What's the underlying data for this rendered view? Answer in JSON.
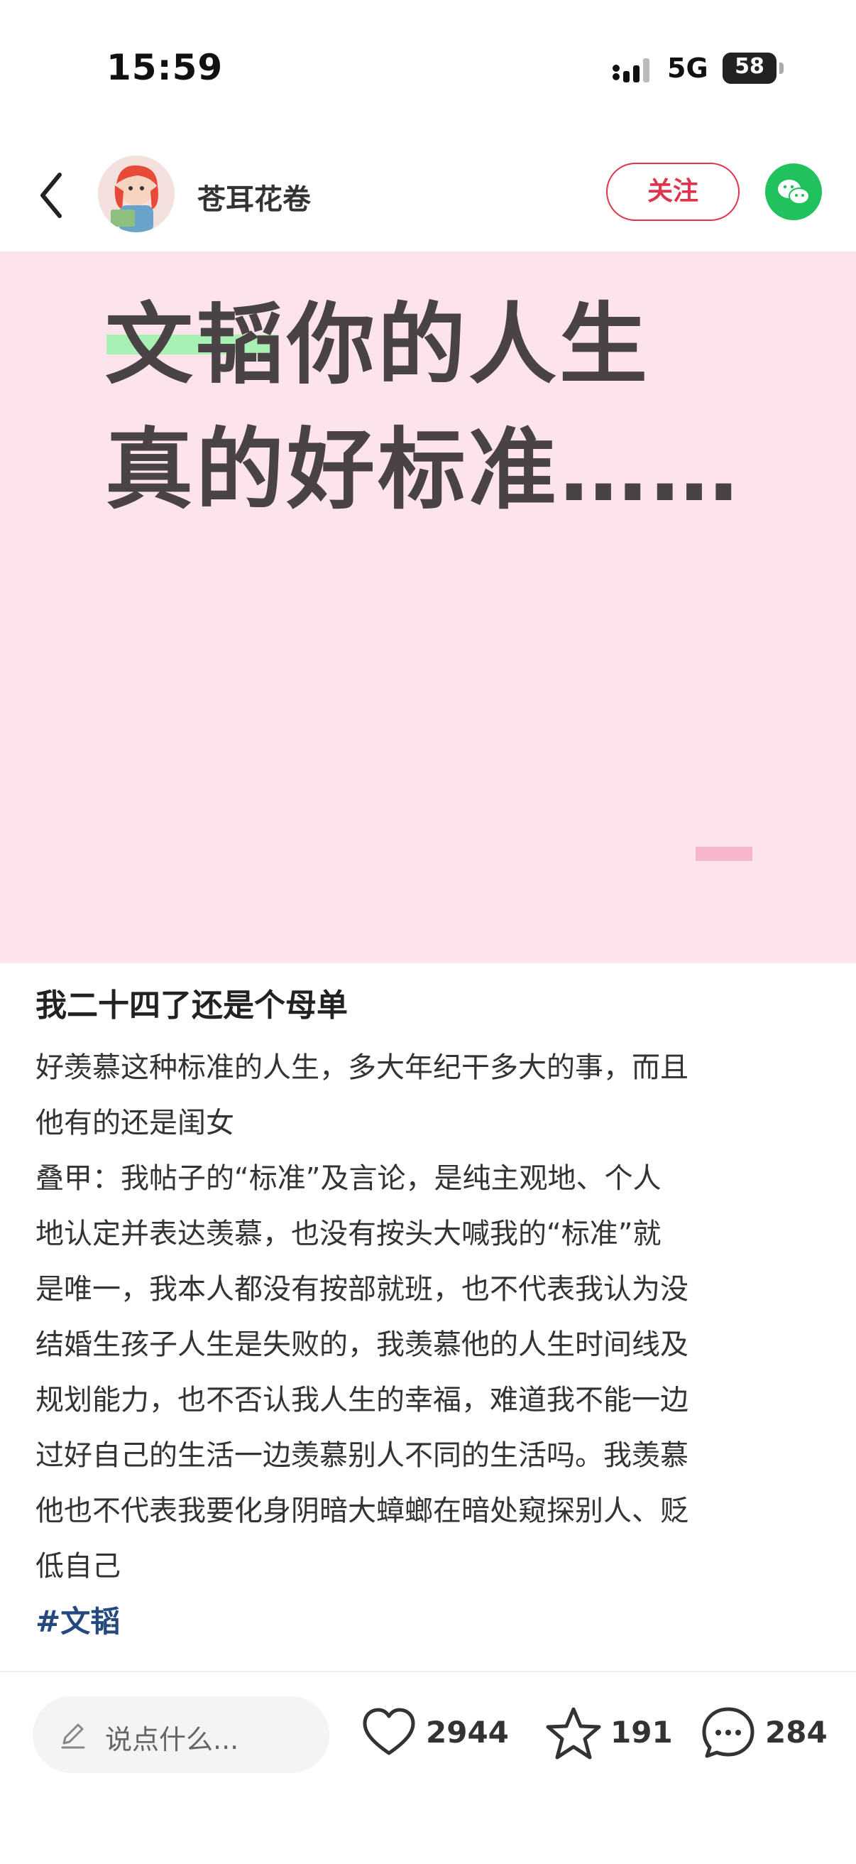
{
  "status_bar": {
    "time": "15:59",
    "network": "5G",
    "battery": "58"
  },
  "header": {
    "author_name": "苍耳花卷",
    "follow_label": "关注",
    "icons": [
      "back-icon",
      "wechat-icon"
    ]
  },
  "cover": {
    "line1": "文韬你的人生",
    "line2": "真的好标准……"
  },
  "post": {
    "title": "我二十四了还是个母单",
    "body": [
      "好羡慕这种标准的人生，多大年纪干多大的事，而且",
      "他有的还是闺女",
      "叠甲：我帖子的“标准”及言论，是纯主观地、个人",
      "地认定并表达羡慕，也没有按头大喊我的“标准”就",
      "是唯一，我本人都没有按部就班，也不代表我认为没",
      "结婚生孩子人生是失败的，我羡慕他的人生时间线及",
      "规划能力，也不否认我人生的幸福，难道我不能一边",
      "过好自己的生活一边羡慕别人不同的生活吗。我羡慕",
      "他也不代表我要化身阴暗大蟑螂在暗处窥探别人、贬",
      "低自己"
    ],
    "hashtag": "#文韬"
  },
  "bottom_bar": {
    "comment_placeholder": "说点什么...",
    "likes": "2944",
    "favorites": "191",
    "comments": "284"
  },
  "colors": {
    "accent": "#e0344c",
    "cover_bg": "#fde3ec",
    "highlight": "#a8f0b4",
    "hashtag": "#23497e",
    "wechat": "#21c25e"
  }
}
